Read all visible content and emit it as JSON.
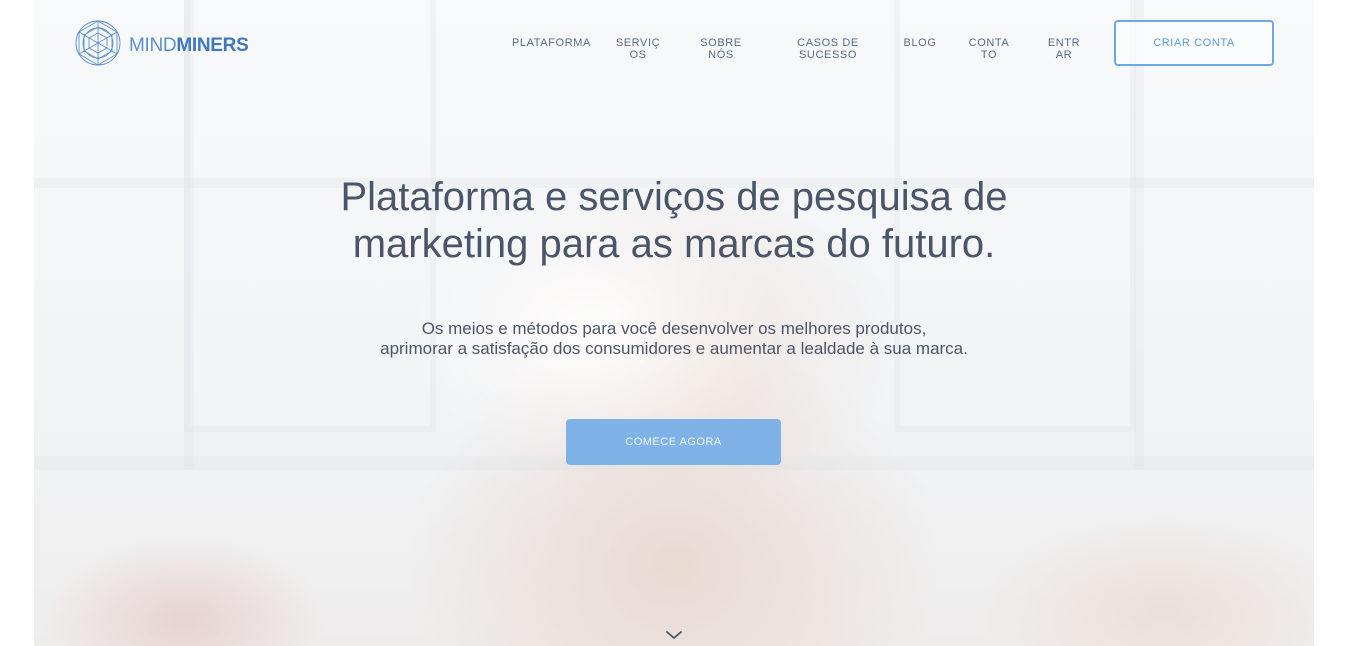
{
  "brand": {
    "logo_text_thin": "MIND",
    "logo_text_bold": "MINERS",
    "logo_icon": "geodesic-sphere-icon",
    "color_primary": "#4a84c2"
  },
  "nav": {
    "items": [
      {
        "id": "plataforma",
        "label": "PLATAFORMA"
      },
      {
        "id": "servicos",
        "label": "SERVIÇOS"
      },
      {
        "id": "sobre",
        "label": "SOBRE NÓS"
      },
      {
        "id": "casos",
        "label": "CASOS DE SUCESSO"
      },
      {
        "id": "blog",
        "label": "BLOG"
      },
      {
        "id": "contato",
        "label": "CONTATO"
      },
      {
        "id": "entrar",
        "label": "ENTRAR"
      }
    ],
    "cta_label": "CRIAR CONTA"
  },
  "hero": {
    "headline_line1": "Plataforma e serviços de pesquisa de",
    "headline_line2": "marketing para as marcas do futuro.",
    "sub_line1": "Os meios e métodos para você desenvolver os melhores produtos,",
    "sub_line2": "aprimorar a satisfação dos consumidores e aumentar a lealdade à sua marca.",
    "cta_label": "COMECE AGORA",
    "scroll_icon": "chevron-down-icon"
  }
}
